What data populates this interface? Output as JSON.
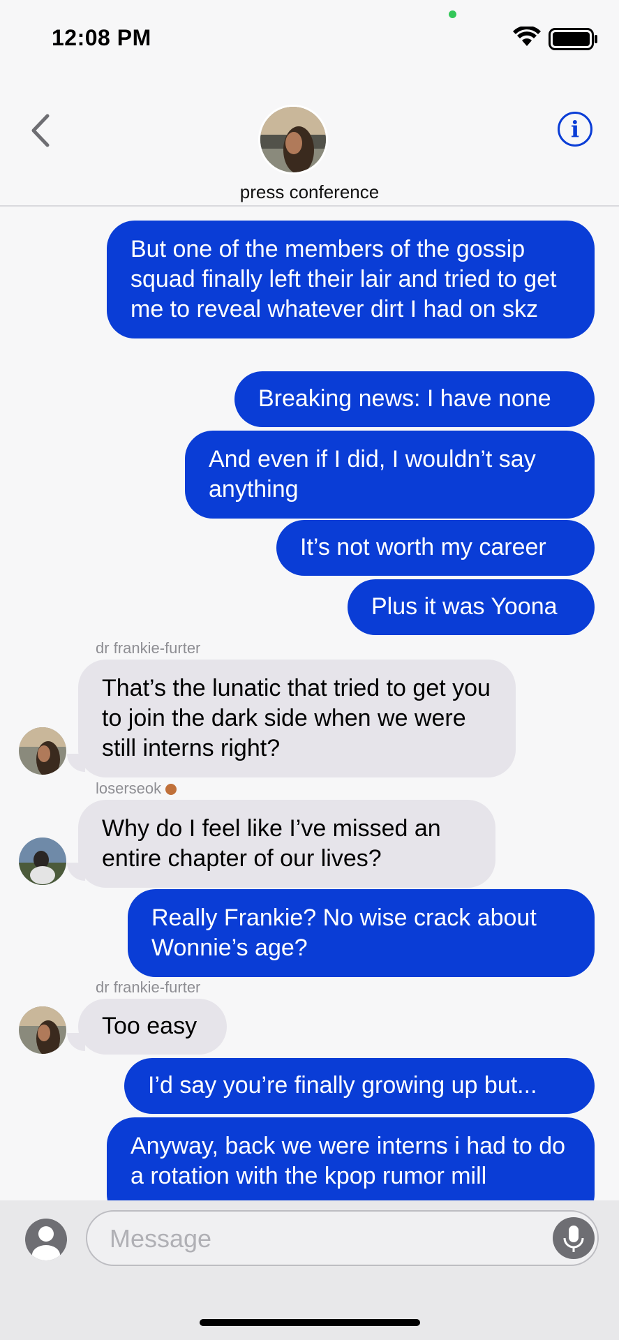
{
  "status": {
    "time": "12:08 PM"
  },
  "header": {
    "group_name": "press conference"
  },
  "messages": [
    {
      "dir": "out",
      "text": "But one of the members of the gossip squad finally left their lair and tried to get me to reveal whatever dirt I had on skz"
    },
    {
      "dir": "out",
      "text": "Breaking news: I have none"
    },
    {
      "dir": "out",
      "text": "And even if I did, I wouldn’t say anything"
    },
    {
      "dir": "out",
      "text": "It’s not worth my career"
    },
    {
      "dir": "out",
      "text": "Plus it was Yoona"
    },
    {
      "dir": "in",
      "sender": "dr frankie-furter",
      "text": "That’s the lunatic that tried to get you to join the dark side when we were still interns right?"
    },
    {
      "dir": "in",
      "sender": "loserseok",
      "text": "Why do I feel like I’ve missed an entire chapter of our lives?"
    },
    {
      "dir": "out",
      "text": "Really Frankie? No wise crack about Wonnie’s age?"
    },
    {
      "dir": "in",
      "sender": "dr frankie-furter",
      "text": "Too easy"
    },
    {
      "dir": "out",
      "text": "I’d say you’re finally growing up but..."
    },
    {
      "dir": "out",
      "text": "Anyway, back we were interns i had to do a rotation with the kpop rumor mill"
    }
  ],
  "input": {
    "placeholder": "Message"
  },
  "icons": {
    "back": "chevron-left-icon",
    "info": "info-icon",
    "mic": "microphone-icon",
    "profile": "person-icon",
    "medal": "medal-icon"
  },
  "colors": {
    "accent": "#0a3dd6",
    "incoming": "#e6e4ea",
    "background": "#f7f7f8"
  }
}
